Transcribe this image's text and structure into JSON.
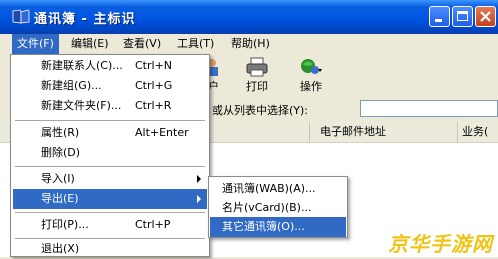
{
  "window": {
    "title": "通讯簿 - 主标识"
  },
  "menubar": {
    "items": [
      "文件(F)",
      "编辑(E)",
      "查看(V)",
      "工具(T)",
      "帮助(H)"
    ]
  },
  "toolbar": {
    "user_partial": "户",
    "print": "打印",
    "action": "操作"
  },
  "search": {
    "label": "或从列表中选择(Y):",
    "value": ""
  },
  "columns": {
    "email": "电子邮件地址",
    "business": "业务("
  },
  "file_menu": {
    "items": [
      {
        "label": "新建联系人(C)...",
        "shortcut": "Ctrl+N"
      },
      {
        "label": "新建组(G)...",
        "shortcut": "Ctrl+G"
      },
      {
        "label": "新建文件夹(F)...",
        "shortcut": "Ctrl+R"
      },
      {
        "label": "属性(R)",
        "shortcut": "Alt+Enter"
      },
      {
        "label": "删除(D)",
        "shortcut": ""
      },
      {
        "label": "导入(I)",
        "shortcut": ""
      },
      {
        "label": "导出(E)",
        "shortcut": ""
      },
      {
        "label": "打印(P)...",
        "shortcut": "Ctrl+P"
      },
      {
        "label": "退出(X)",
        "shortcut": ""
      }
    ]
  },
  "export_submenu": {
    "items": [
      {
        "label": "通讯簿(WAB)(A)..."
      },
      {
        "label": "名片(vCard)(B)..."
      },
      {
        "label": "其它通讯簿(O)..."
      }
    ]
  },
  "watermark": "京华手游网",
  "colors": {
    "highlight": "#316ac5",
    "titlebar": "#0054e3",
    "watermark": "#f0c417"
  }
}
